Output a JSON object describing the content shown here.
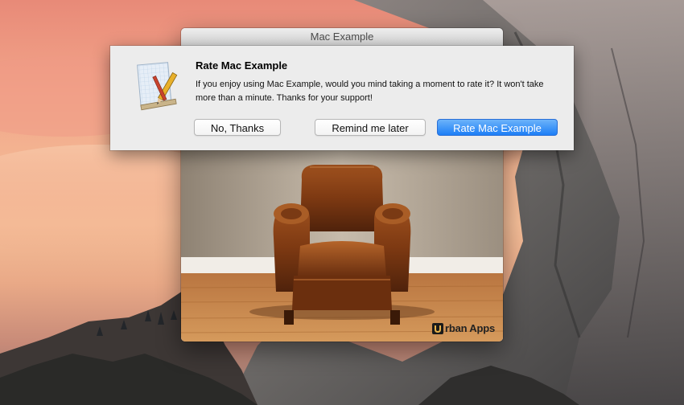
{
  "window": {
    "title": "Mac Example"
  },
  "alert": {
    "title": "Rate Mac Example",
    "message": "If you enjoy using Mac Example, would you mind taking a moment to rate it? It won't take more than a minute. Thanks for your support!",
    "buttons": {
      "no_thanks": "No, Thanks",
      "remind_later": "Remind me later",
      "rate": "Rate Mac Example"
    }
  },
  "content": {
    "brand_text": "rban Apps",
    "image": "leather-armchair-photo"
  },
  "colors": {
    "primary_button": "#1d7ef6",
    "sheet_background": "#ececec"
  }
}
